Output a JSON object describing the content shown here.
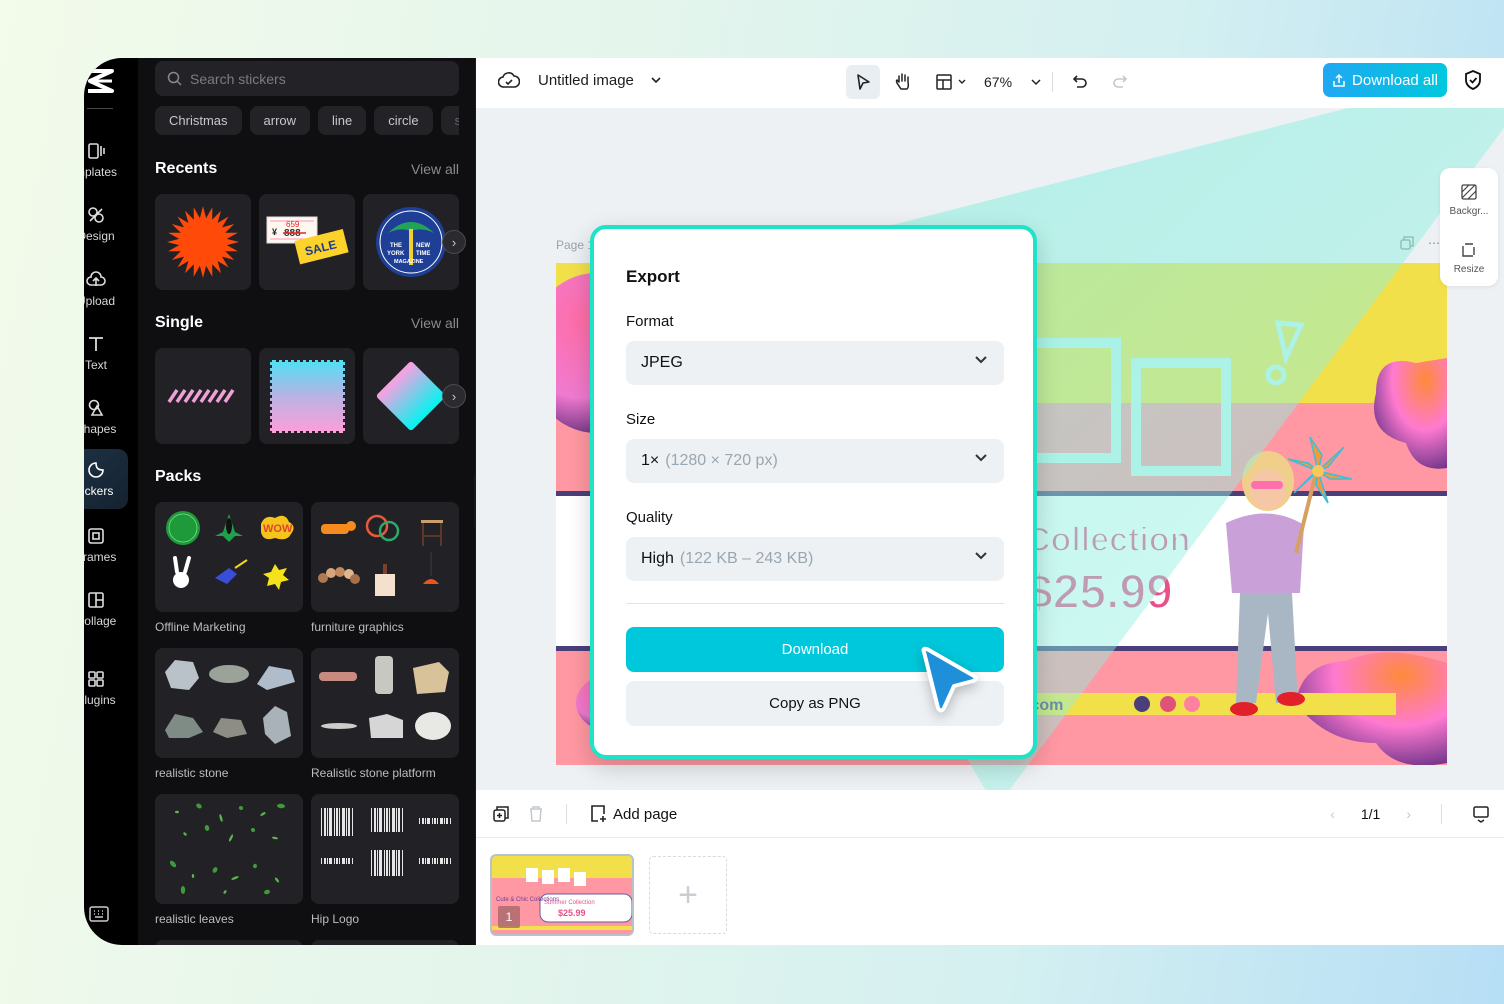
{
  "nav_rail": {
    "items": [
      {
        "label": "Templates",
        "visible_label": "mplates",
        "icon": "templates-icon"
      },
      {
        "label": "Design",
        "visible_label": "Design",
        "icon": "design-icon"
      },
      {
        "label": "Upload",
        "visible_label": "Upload",
        "icon": "upload-icon"
      },
      {
        "label": "Text",
        "visible_label": "Text",
        "icon": "text-icon"
      },
      {
        "label": "Shapes",
        "visible_label": "Shapes",
        "icon": "shapes-icon"
      },
      {
        "label": "Stickers",
        "visible_label": "tickers",
        "icon": "stickers-icon",
        "active": true
      },
      {
        "label": "Frames",
        "visible_label": "Frames",
        "icon": "frames-icon"
      },
      {
        "label": "Collage",
        "visible_label": "Collage",
        "icon": "collage-icon"
      },
      {
        "label": "Plugins",
        "visible_label": "Plugins",
        "icon": "plugins-icon"
      }
    ]
  },
  "stickers_panel": {
    "search_placeholder": "Search stickers",
    "chips": [
      "Christmas",
      "arrow",
      "line",
      "circle",
      "s"
    ],
    "recents": {
      "title": "Recents",
      "view_all": "View all",
      "items": [
        "orange-starburst",
        "sale-price-tag",
        "new-york-time-magazine-badge"
      ],
      "sale_tag_text": "SALE",
      "price_old": "888",
      "price_new": "659",
      "currency": "¥",
      "badge_lines": [
        "THE",
        "NEW",
        "YORK",
        "TIME",
        "MAGAZINE"
      ]
    },
    "single": {
      "title": "Single",
      "view_all": "View all",
      "items": [
        "pink-stripes",
        "gradient-stamp",
        "gradient-diamond"
      ]
    },
    "packs": {
      "title": "Packs",
      "items": [
        {
          "label": "Offline Marketing"
        },
        {
          "label": "furniture graphics"
        },
        {
          "label": "realistic stone"
        },
        {
          "label": "Realistic stone platform"
        },
        {
          "label": "realistic leaves"
        },
        {
          "label": "Hip Logo"
        }
      ]
    }
  },
  "topbar": {
    "title": "Untitled image",
    "zoom": "67%",
    "download_all": "Download all"
  },
  "canvas": {
    "page_label": "Page 1",
    "side_tools": [
      {
        "label": "Backgr..."
      },
      {
        "label": "Resize"
      }
    ],
    "design": {
      "headline": "Collection",
      "price": "$25.99",
      "url_fragment": ".com",
      "colors": {
        "yellow": "#f2e04a",
        "pink": "#ff98a2",
        "white": "#ffffff",
        "navy": "#4a3f7a"
      }
    }
  },
  "export_modal": {
    "title": "Export",
    "format_label": "Format",
    "format_value": "JPEG",
    "size_label": "Size",
    "size_value": "1×",
    "size_hint": "(1280 × 720 px)",
    "quality_label": "Quality",
    "quality_value": "High",
    "quality_hint": "(122 KB – 243 KB)",
    "download_label": "Download",
    "copy_label": "Copy as PNG",
    "accent": "#00c8dc",
    "border_color": "#1ee3c9"
  },
  "bottombar": {
    "add_page": "Add page",
    "pagination": "1/1"
  },
  "thumbnails": {
    "pages": [
      {
        "number": "1",
        "headline": "Cute & Chic Collections",
        "sub": "Summer Collection",
        "price": "$25.99"
      }
    ]
  }
}
